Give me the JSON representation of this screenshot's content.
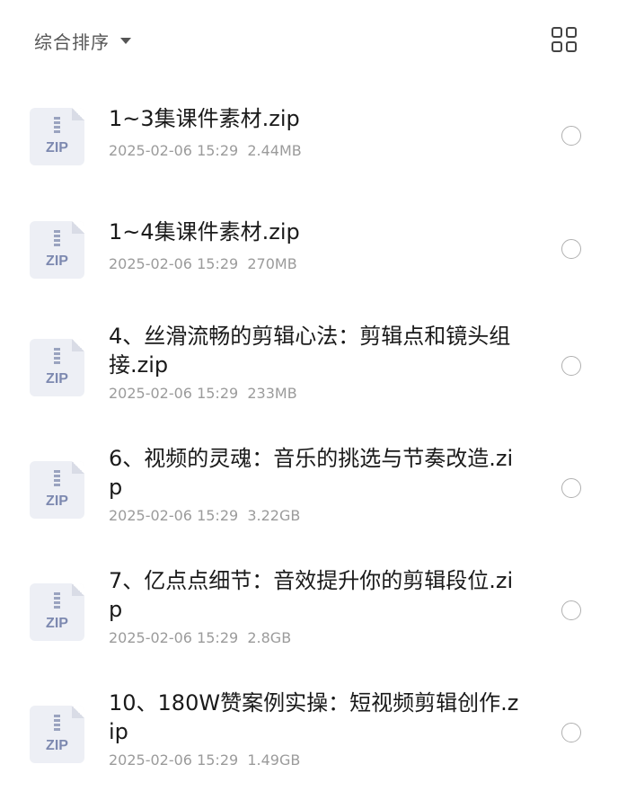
{
  "toolbar": {
    "sort_label": "综合排序",
    "sort_icon": "caret-down-icon",
    "view_icon": "grid-view-icon"
  },
  "files": [
    {
      "name": "1~3集课件素材.zip",
      "date": "2025-02-06 15:29",
      "size": "2.44MB",
      "type_label": "ZIP"
    },
    {
      "name": "1~4集课件素材.zip",
      "date": "2025-02-06 15:29",
      "size": "270MB",
      "type_label": "ZIP"
    },
    {
      "name": "4、丝滑流畅的剪辑心法：剪辑点和镜头组接.zip",
      "date": "2025-02-06 15:29",
      "size": "233MB",
      "type_label": "ZIP"
    },
    {
      "name": "6、视频的灵魂：音乐的挑选与节奏改造.zip",
      "date": "2025-02-06 15:29",
      "size": "3.22GB",
      "type_label": "ZIP"
    },
    {
      "name": "7、亿点点细节：音效提升你的剪辑段位.zip",
      "date": "2025-02-06 15:29",
      "size": "2.8GB",
      "type_label": "ZIP"
    },
    {
      "name": "10、180W赞案例实操：短视频剪辑创作.zip",
      "date": "2025-02-06 15:29",
      "size": "1.49GB",
      "type_label": "ZIP"
    }
  ]
}
